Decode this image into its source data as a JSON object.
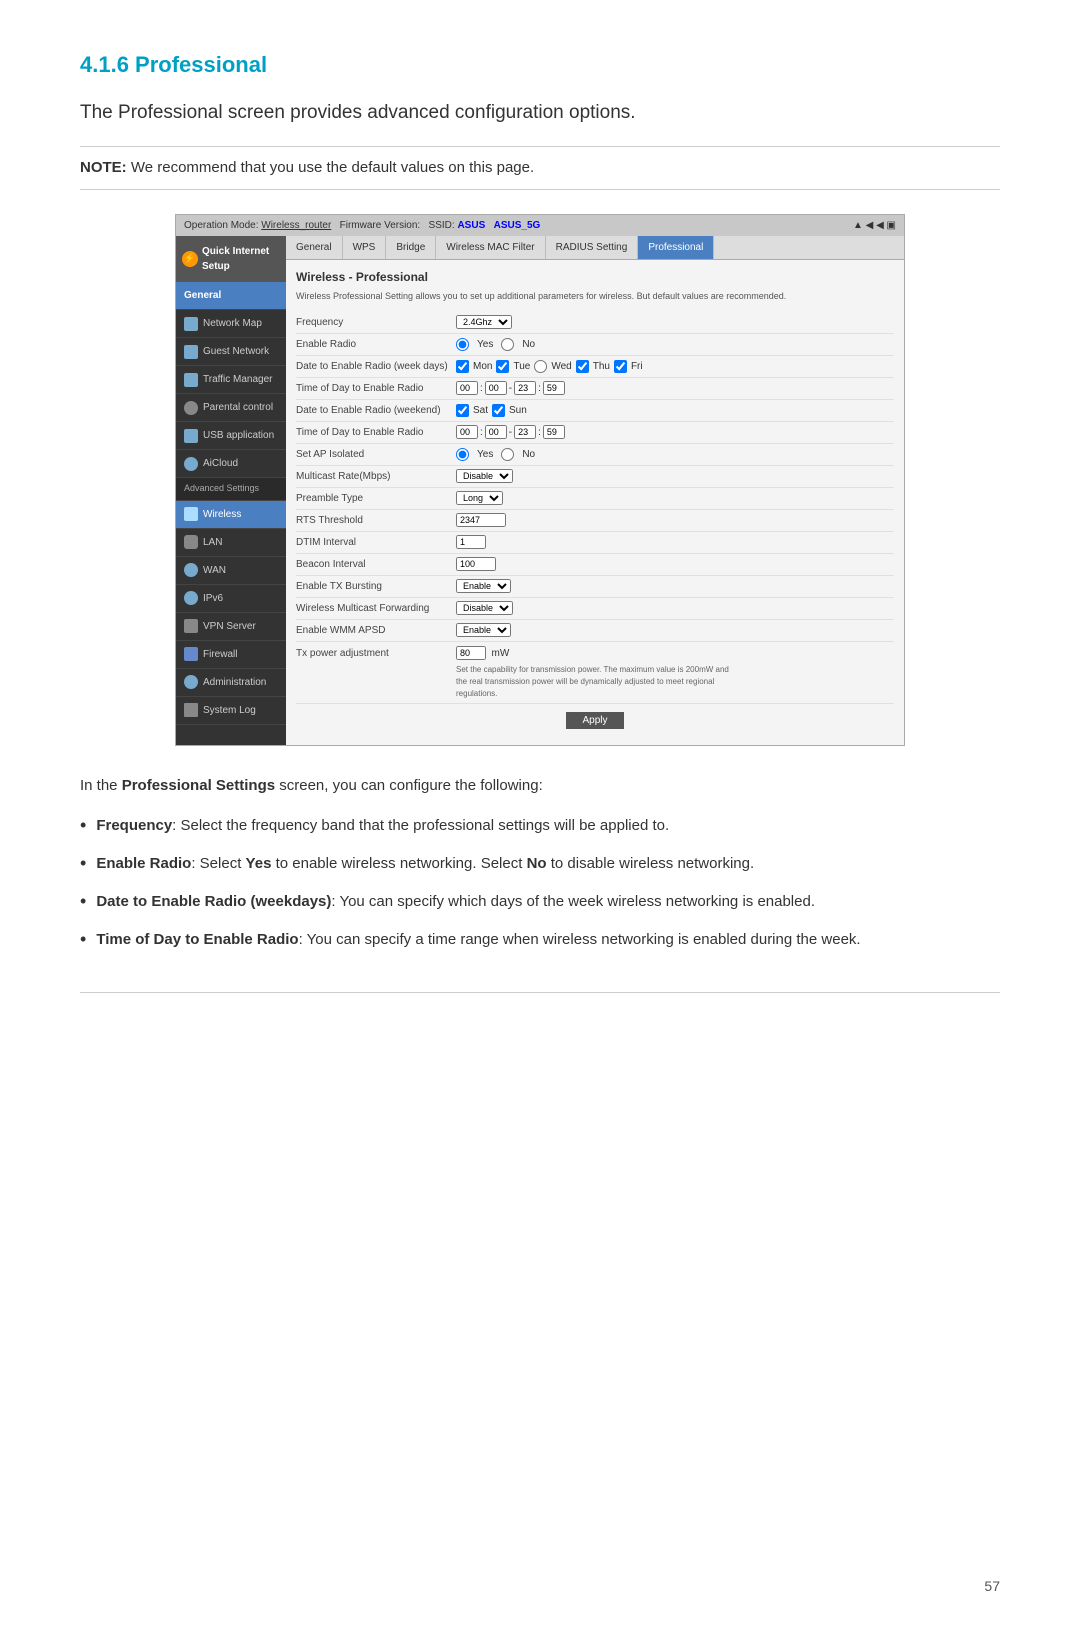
{
  "page": {
    "number": "57"
  },
  "header": {
    "section_number": "4.1.6 Professional",
    "intro": "The Professional screen provides advanced configuration options.",
    "note_label": "NOTE:",
    "note_text": " We recommend that you use the default values on this page."
  },
  "router_ui": {
    "topbar": {
      "operation": "Operation Mode: Wireless_router",
      "firmware": "Firmware Version:",
      "ssid": "SSID: ASUS  ASUS_5G",
      "icons": "▲ ◀ ◀ ▣"
    },
    "tabs": [
      "General",
      "WPS",
      "Bridge",
      "Wireless MAC Filter",
      "RADIUS Setting",
      "Professional"
    ],
    "sidebar": {
      "header": "Quick Internet Setup",
      "items": [
        {
          "label": "General",
          "type": "section"
        },
        {
          "label": "Network Map",
          "icon": "🗺"
        },
        {
          "label": "Guest Network",
          "icon": "👥"
        },
        {
          "label": "Traffic Manager",
          "icon": "📊"
        },
        {
          "label": "Parental control",
          "icon": "🔒"
        },
        {
          "label": "USB application",
          "icon": "🔌"
        },
        {
          "label": "AiCloud",
          "icon": "☁"
        },
        {
          "label": "Advanced Settings",
          "type": "section"
        },
        {
          "label": "Wireless",
          "active": true
        },
        {
          "label": "LAN",
          "icon": "🏠"
        },
        {
          "label": "WAN",
          "icon": "🌐"
        },
        {
          "label": "IPv6",
          "icon": "🌐"
        },
        {
          "label": "VPN Server",
          "icon": "🔒"
        },
        {
          "label": "Firewall",
          "icon": "🛡"
        },
        {
          "label": "Administration",
          "icon": "👤"
        },
        {
          "label": "System Log",
          "icon": "📄"
        }
      ]
    },
    "content": {
      "title": "Wireless - Professional",
      "description": "Wireless Professional Setting allows you to set up additional parameters for wireless. But default values are recommended.",
      "fields": [
        {
          "label": "Frequency",
          "value": "2.4GHz ▼",
          "type": "select"
        },
        {
          "label": "Enable Radio",
          "value": "● Yes ○ No",
          "type": "radio"
        },
        {
          "label": "Date to Enable Radio (week days)",
          "value": "☑ Mon ☑ Tue ● Wed ☑ Thu ☑ Fri",
          "type": "checkbox"
        },
        {
          "label": "Time of Day to Enable Radio",
          "value": "00 : 00 - 23 : 59",
          "type": "time"
        },
        {
          "label": "Date to Enable Radio (weekend)",
          "value": "☑ Sat ☑ Sun",
          "type": "checkbox"
        },
        {
          "label": "Time of Day to Enable Radio",
          "value": "00 : 00 - 23 : 59",
          "type": "time"
        },
        {
          "label": "Set AP Isolated",
          "value": "● Yes ○ No",
          "type": "radio"
        },
        {
          "label": "Multicast Rate(Mbps)",
          "value": "Disable ▼",
          "type": "select"
        },
        {
          "label": "Preamble Type",
          "value": "Long ▼",
          "type": "select"
        },
        {
          "label": "RTS Threshold",
          "value": "2347",
          "type": "input"
        },
        {
          "label": "DTIM Interval",
          "value": "1",
          "type": "input"
        },
        {
          "label": "Beacon Interval",
          "value": "100",
          "type": "input"
        },
        {
          "label": "Enable TX Bursting",
          "value": "Enable ▼",
          "type": "select"
        },
        {
          "label": "Wireless Multicast Forwarding",
          "value": "Disable ▼",
          "type": "select"
        },
        {
          "label": "Enable WMM APSD",
          "value": "Enable ▼",
          "type": "select"
        },
        {
          "label": "Tx power adjustment",
          "value": "80   mW",
          "type": "power",
          "note": "Set the capability for transmission power. The maximum value is 200mW and the real transmission power will be dynamically adjusted to meet regional regulations."
        }
      ],
      "apply_button": "Apply"
    }
  },
  "body_text": "In the Professional Settings screen, you can configure the following:",
  "bullets": [
    {
      "term": "Frequency",
      "colon": ":",
      "text": "  Select the frequency band that the professional settings will be applied to."
    },
    {
      "term": "Enable Radio",
      "colon": ":",
      "text": "  Select ",
      "bold2": "Yes",
      "text2": " to enable wireless networking. Select ",
      "bold3": "No",
      "text3": " to disable wireless networking."
    },
    {
      "term": "Date to Enable Radio (weekdays)",
      "colon": ":",
      "text": "  You can specify which days of the week wireless networking is enabled."
    },
    {
      "term": "Time of Day to Enable Radio",
      "colon": ":",
      "text": "  You can specify a time range when wireless networking is enabled during the week."
    }
  ]
}
